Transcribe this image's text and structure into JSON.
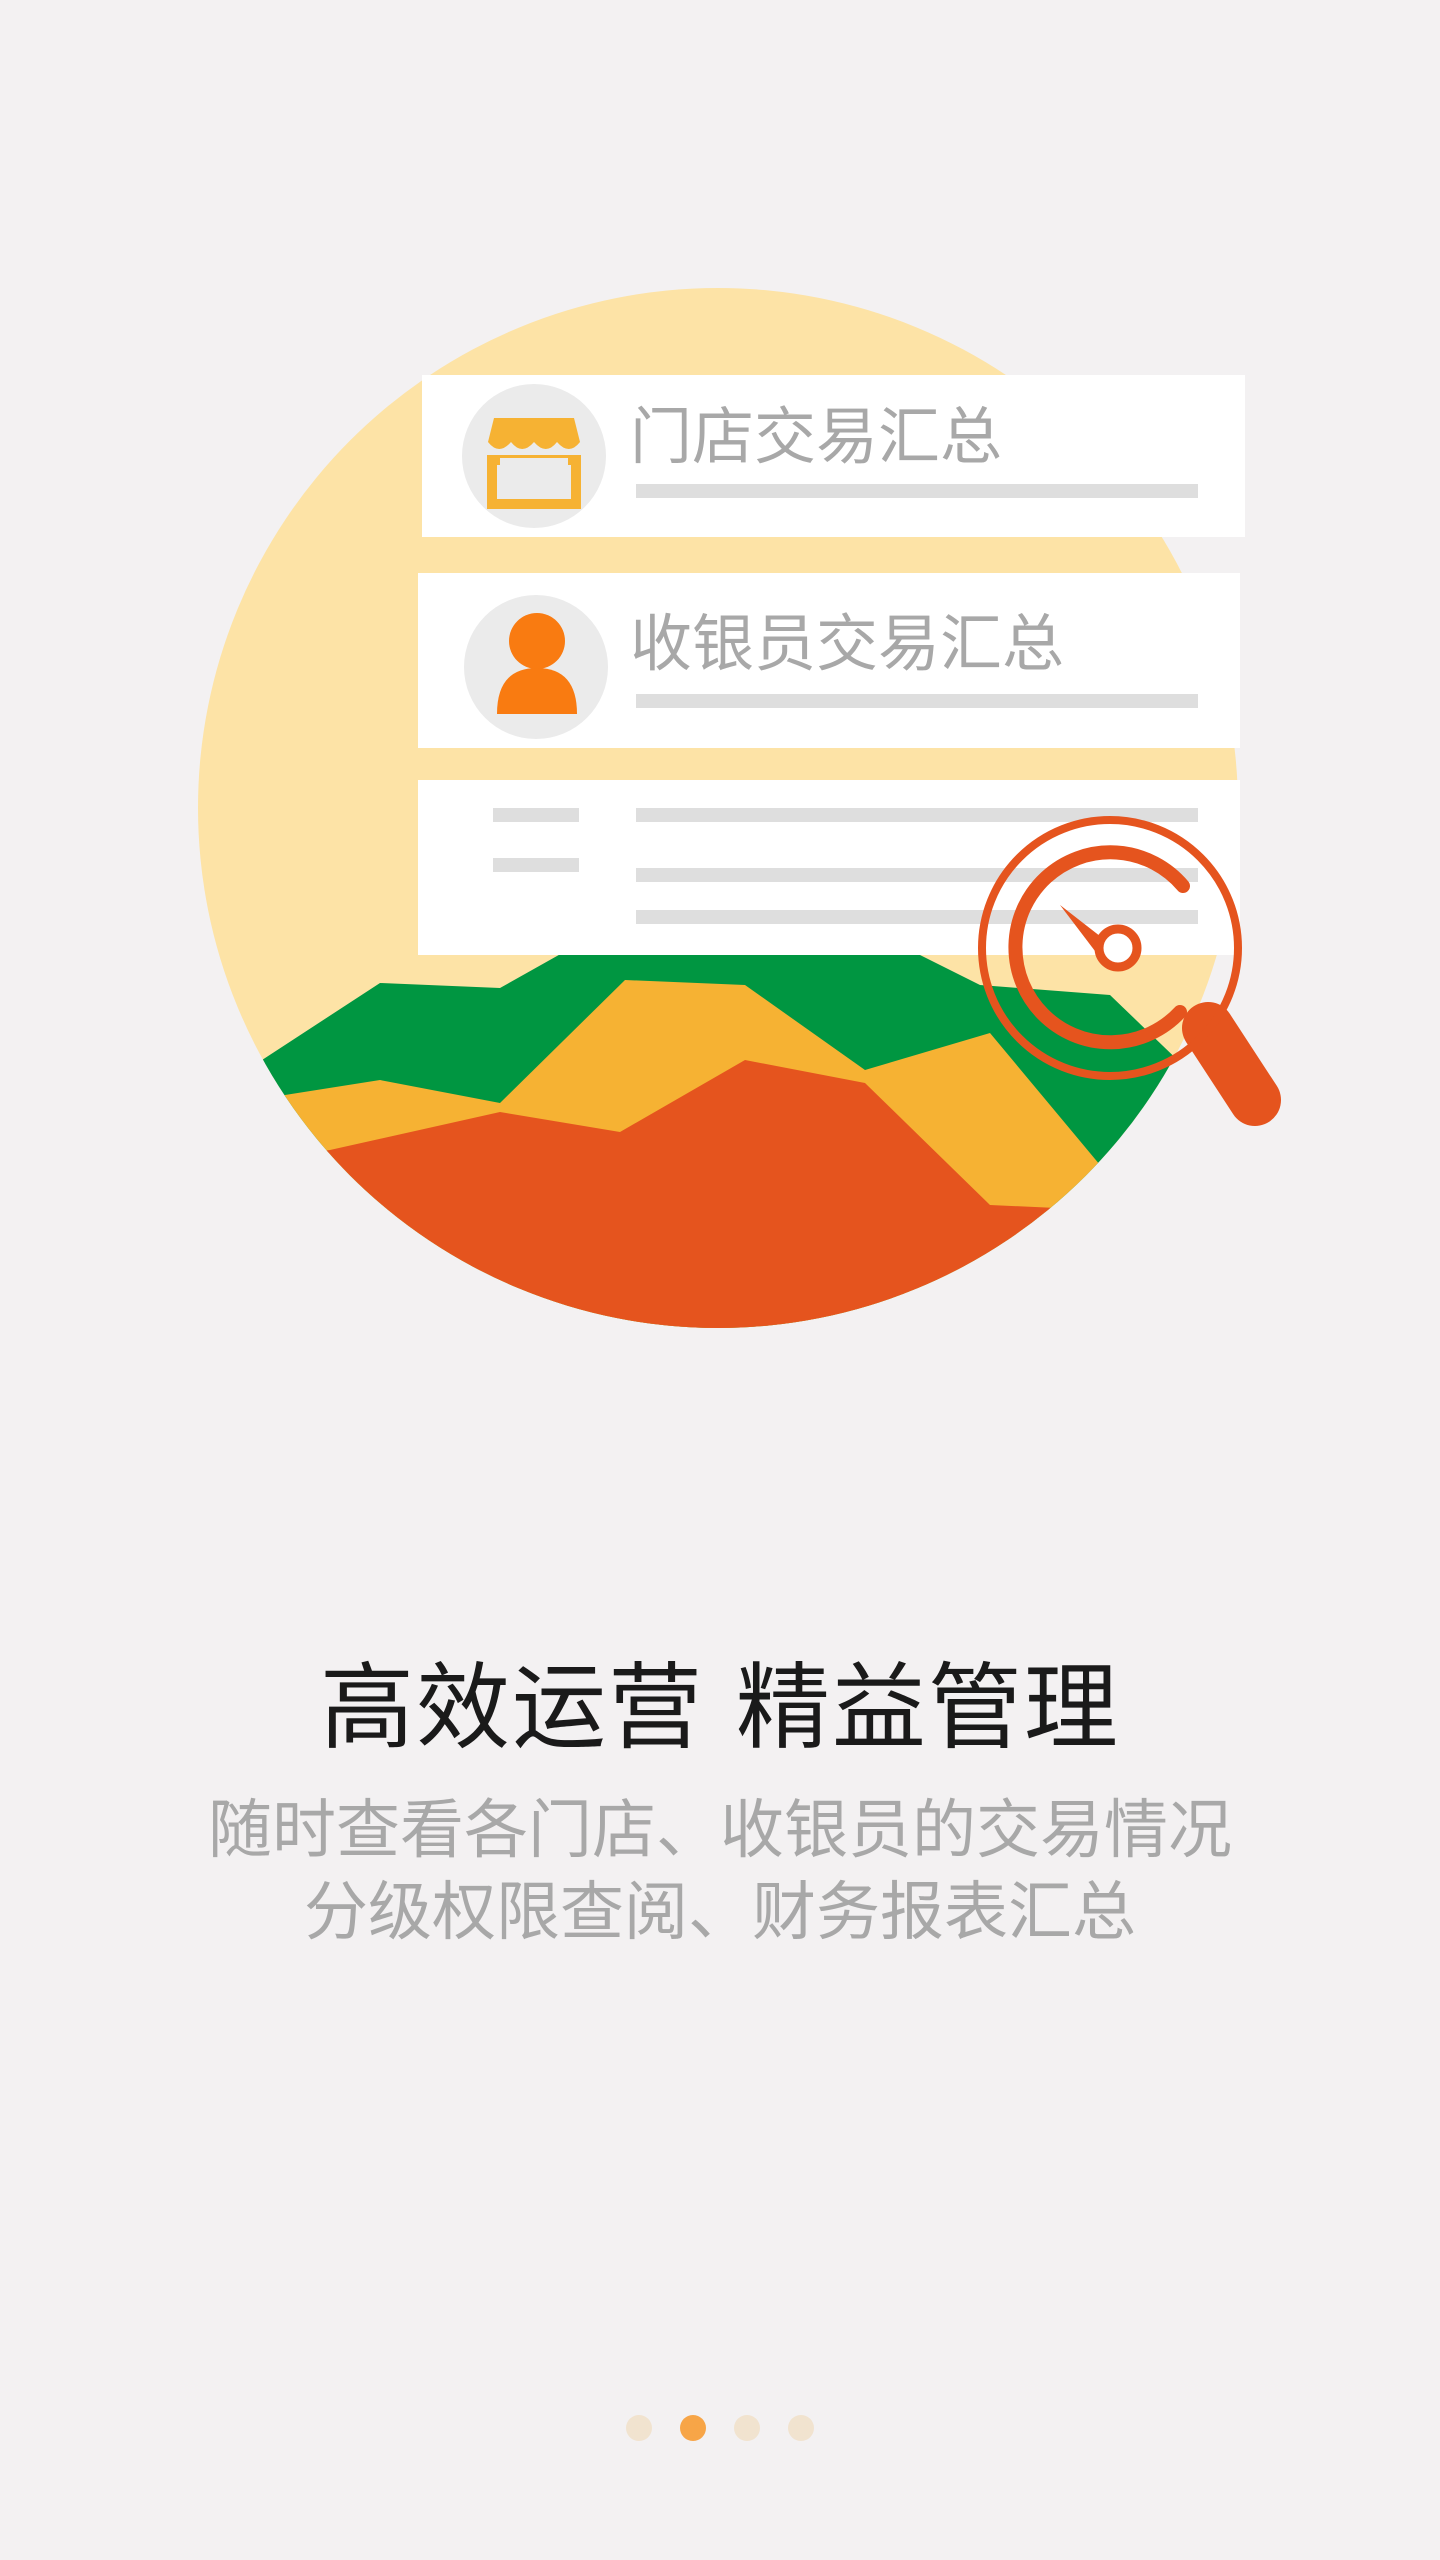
{
  "cards": [
    {
      "label": "门店交易汇总",
      "icon": "store-icon"
    },
    {
      "label": "收银员交易汇总",
      "icon": "user-icon"
    }
  ],
  "headline": "高效运营 精益管理",
  "description": [
    "随时查看各门店、收银员的交易情况",
    "分级权限查阅、财务报表汇总"
  ],
  "pager": {
    "count": 4,
    "active_index": 1
  },
  "colors": {
    "background": "#f3f1f2",
    "circle": "#fde3a6",
    "green": "#009641",
    "yellow": "#f6b233",
    "orange": "#e5541e",
    "accent_dot": "#f7a547"
  }
}
